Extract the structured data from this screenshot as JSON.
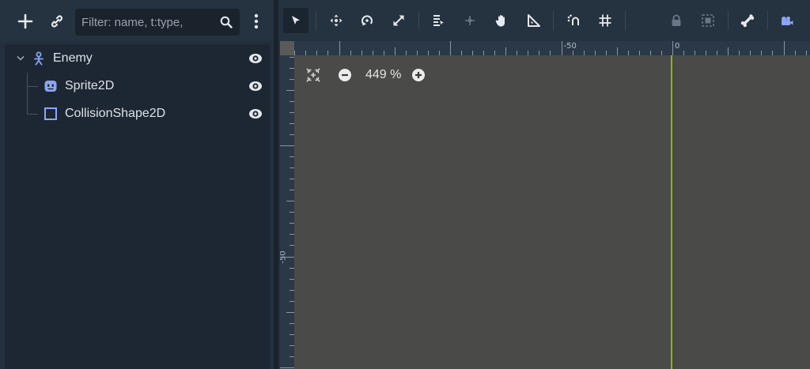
{
  "scene_dock": {
    "filter_placeholder": "Filter: name, t:type,",
    "tree": [
      {
        "label": "Enemy",
        "icon": "node2d-icon",
        "expanded": true
      },
      {
        "label": "Sprite2D",
        "icon": "sprite2d-icon"
      },
      {
        "label": "CollisionShape2D",
        "icon": "collisionshape2d-icon"
      }
    ]
  },
  "editor": {
    "zoom": "449 %",
    "ruler_top_labels": [
      "-50",
      "0"
    ],
    "ruler_left_labels": [
      "-50"
    ]
  },
  "colors": {
    "node_blue": "#8da5f3",
    "axis_green": "#85b51c",
    "viewport_bg": "#4a4a49"
  }
}
